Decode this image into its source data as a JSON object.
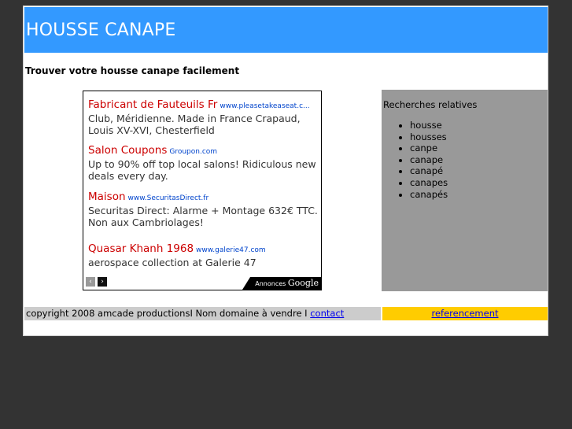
{
  "header": {
    "title": "HOUSSE CANAPE"
  },
  "subtitle": "Trouver votre housse canape facilement",
  "ads": {
    "items": [
      {
        "title": "Fabricant de Fauteuils Fr",
        "url": "www.pleasetakeaseat.c...",
        "text": "Club, Méridienne. Made in France Crapaud, Louis XV-XVI, Chesterfield"
      },
      {
        "title": "Salon Coupons",
        "url": "Groupon.com",
        "text": "Up to 90% off top local salons! Ridiculous new deals every day."
      },
      {
        "title": "Maison",
        "url": "www.SecuritasDirect.fr",
        "text": "Securitas Direct: Alarme + Montage 632€ TTC. Non aux Cambriolages!"
      },
      {
        "title": "Quasar Khanh 1968",
        "url": "www.galerie47.com",
        "text": "aerospace collection at Galerie 47"
      }
    ],
    "prev_icon": "‹",
    "next_icon": "›",
    "badge_prefix": "Annonces",
    "badge_brand": "Google"
  },
  "related": {
    "title": "Recherches relatives",
    "items": [
      "housse",
      "housses",
      "canpe",
      "canape",
      "canapé",
      "canapes",
      "canapés"
    ]
  },
  "footer": {
    "copyright": "copyright 2008 amcade productionsI Nom domaine à vendre I ",
    "contact_label": "contact",
    "ref_label": "referencement"
  },
  "colors": {
    "page_bg": "#333333",
    "header_bg": "#3399ff",
    "ad_title": "#cc0000",
    "related_bg": "#999999",
    "footer_right_bg": "#ffcc00"
  }
}
